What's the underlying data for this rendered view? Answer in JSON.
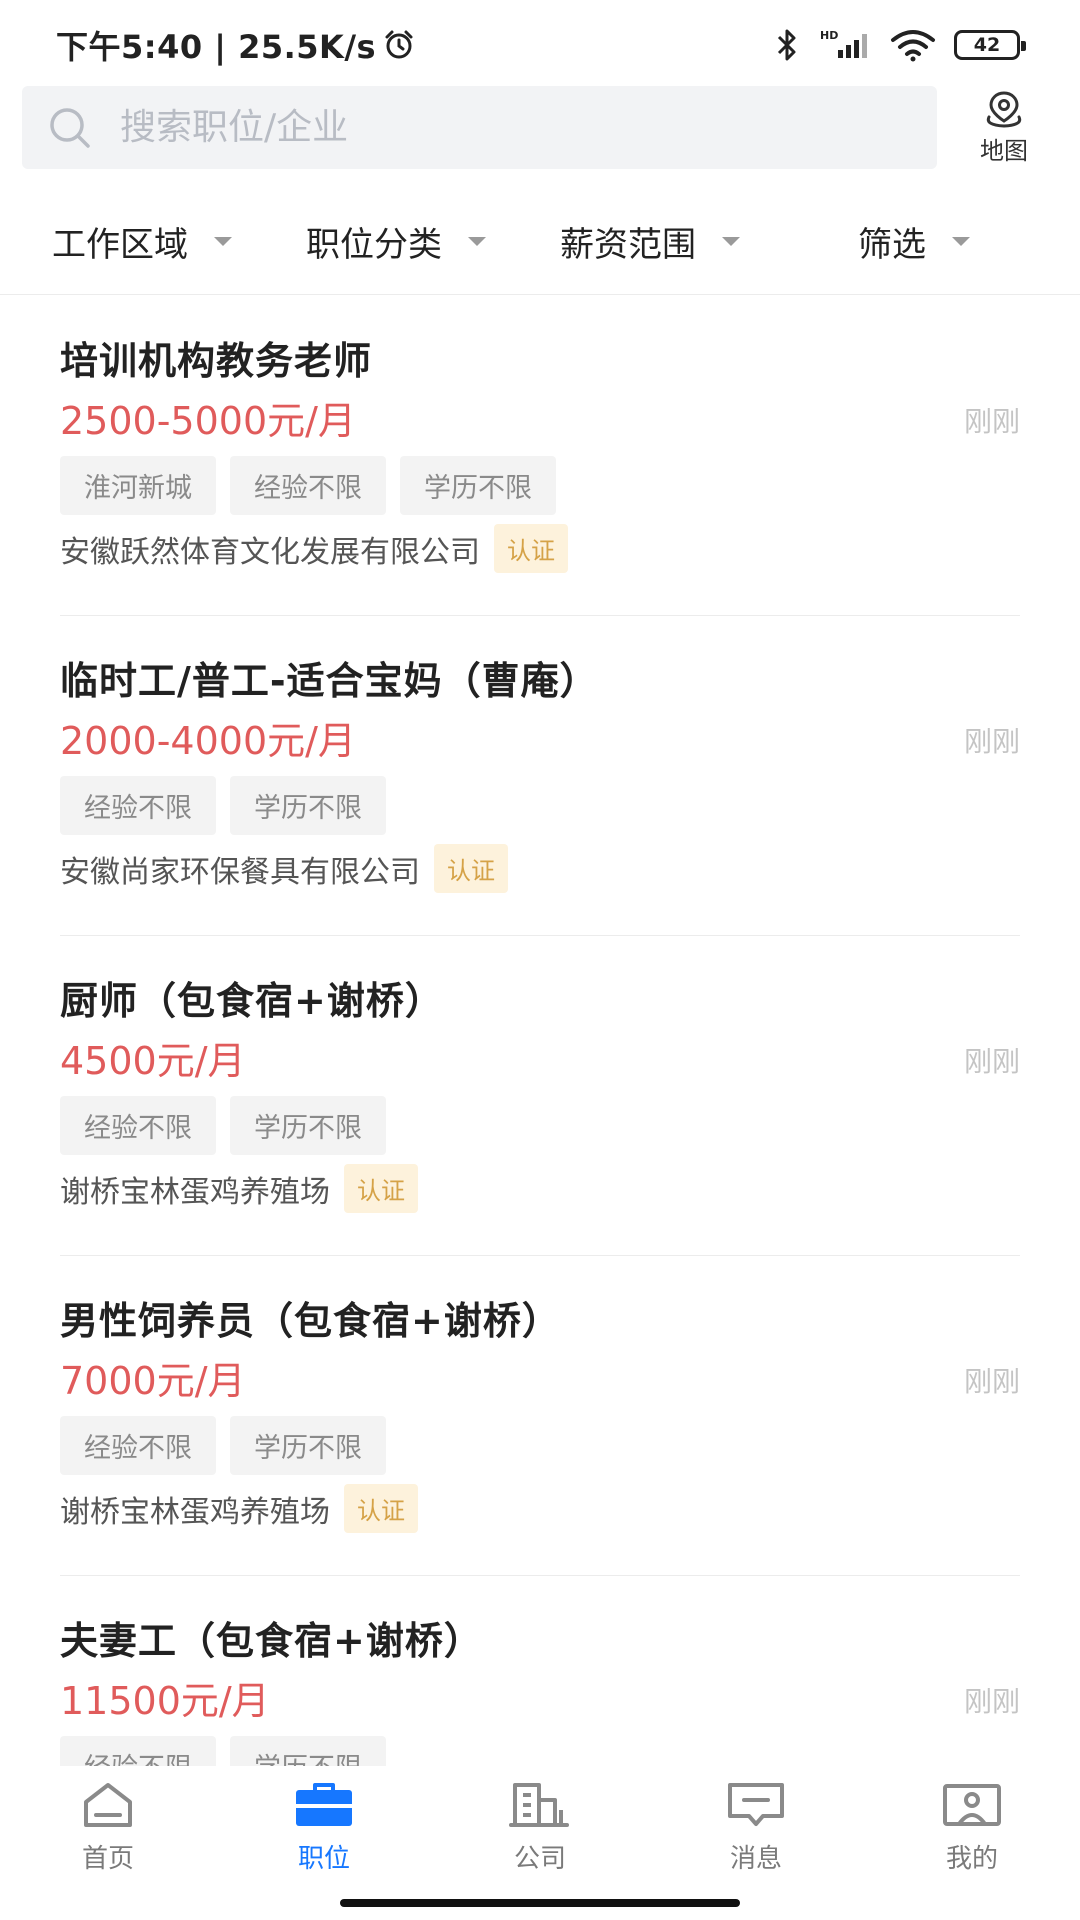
{
  "status_bar": {
    "time_speed": "下午5:40 | 25.5K/s",
    "battery": "42"
  },
  "search": {
    "placeholder": "搜索职位/企业",
    "map_label": "地图"
  },
  "filters": [
    {
      "label": "工作区域"
    },
    {
      "label": "职位分类"
    },
    {
      "label": "薪资范围"
    },
    {
      "label": "筛选"
    }
  ],
  "jobs": [
    {
      "title": "培训机构教务老师",
      "salary": "2500-5000元/月",
      "time": "刚刚",
      "tags": [
        "淮河新城",
        "经验不限",
        "学历不限"
      ],
      "company": "安徽跃然体育文化发展有限公司",
      "cert": "认证"
    },
    {
      "title": "临时工/普工-适合宝妈（曹庵）",
      "salary": "2000-4000元/月",
      "time": "刚刚",
      "tags": [
        "经验不限",
        "学历不限"
      ],
      "company": "安徽尚家环保餐具有限公司",
      "cert": "认证"
    },
    {
      "title": "厨师（包食宿+谢桥）",
      "salary": "4500元/月",
      "time": "刚刚",
      "tags": [
        "经验不限",
        "学历不限"
      ],
      "company": "谢桥宝林蛋鸡养殖场",
      "cert": "认证"
    },
    {
      "title": "男性饲养员（包食宿+谢桥）",
      "salary": "7000元/月",
      "time": "刚刚",
      "tags": [
        "经验不限",
        "学历不限"
      ],
      "company": "谢桥宝林蛋鸡养殖场",
      "cert": "认证"
    },
    {
      "title": "夫妻工（包食宿+谢桥）",
      "salary": "11500元/月",
      "time": "刚刚",
      "tags": [
        "经验不限",
        "学历不限"
      ],
      "company": "",
      "cert": ""
    }
  ],
  "tab_bar": [
    {
      "label": "首页",
      "icon": "home-icon"
    },
    {
      "label": "职位",
      "icon": "briefcase-icon",
      "active": true
    },
    {
      "label": "公司",
      "icon": "building-icon"
    },
    {
      "label": "消息",
      "icon": "message-icon"
    },
    {
      "label": "我的",
      "icon": "profile-icon"
    }
  ],
  "colors": {
    "accent": "#1677ff",
    "salary": "#e05b5b",
    "cert_bg": "#fdf2dc",
    "cert_text": "#d5a247"
  }
}
